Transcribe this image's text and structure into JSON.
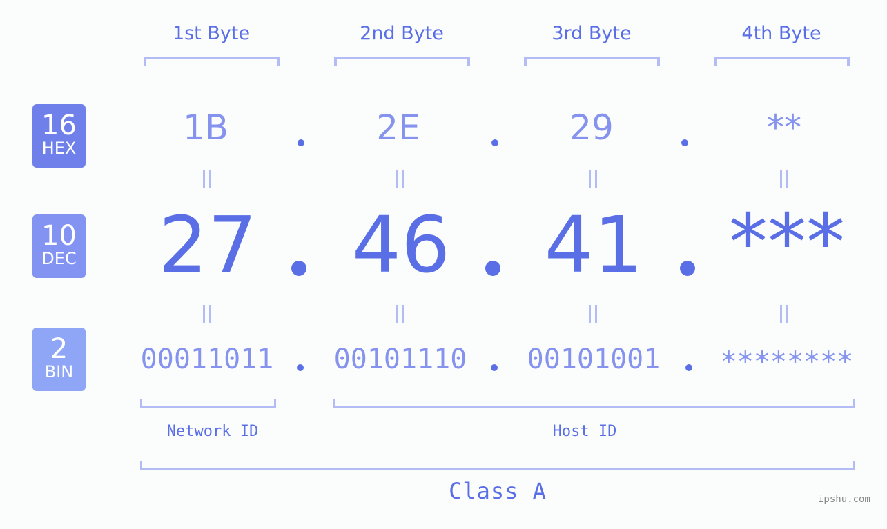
{
  "byte_headers": [
    "1st Byte",
    "2nd Byte",
    "3rd Byte",
    "4th Byte"
  ],
  "badges": {
    "hex": {
      "number": "16",
      "label": "HEX",
      "color": "#6f80ea"
    },
    "dec": {
      "number": "10",
      "label": "DEC",
      "color": "#8393f2"
    },
    "bin": {
      "number": "2",
      "label": "BIN",
      "color": "#8fa6f7"
    }
  },
  "hex_values": [
    "1B",
    "2E",
    "29",
    "**"
  ],
  "dec_values": [
    "27",
    "46",
    "41",
    "***"
  ],
  "bin_values": [
    "00011011",
    "00101110",
    "00101001",
    "********"
  ],
  "network_id_label": "Network ID",
  "host_id_label": "Host ID",
  "class_label": "Class A",
  "watermark": "ipshu.com",
  "colors": {
    "primary": "#5a6ee6",
    "light": "#8593ee",
    "bracket": "#b3bcf5",
    "background": "#fbfdfc"
  }
}
